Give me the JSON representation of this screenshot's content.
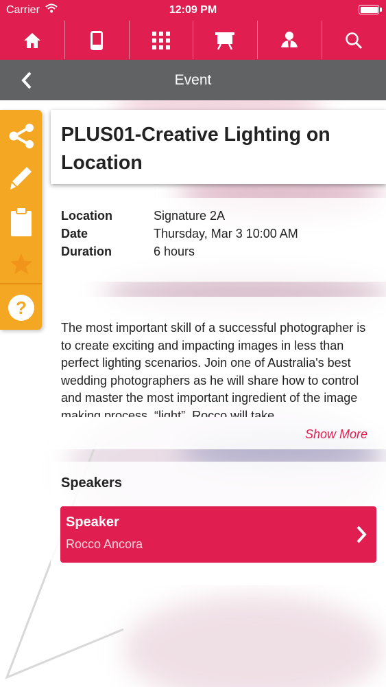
{
  "status_bar": {
    "carrier": "Carrier",
    "time": "12:09 PM"
  },
  "nav_icons": [
    "home-icon",
    "tablet-icon",
    "qr-code-icon",
    "presentation-board-icon",
    "person-icon",
    "search-icon"
  ],
  "header": {
    "title": "Event"
  },
  "sidebar": {
    "icons": [
      "share-icon",
      "pencil-icon",
      "clipboard-icon",
      "star-icon",
      "help-icon"
    ]
  },
  "event": {
    "title": "PLUS01-Creative Lighting on Location",
    "details": [
      {
        "label": "Location",
        "value": "Signature 2A"
      },
      {
        "label": "Date",
        "value": "Thursday, Mar 3 10:00 AM"
      },
      {
        "label": "Duration",
        "value": "6 hours"
      }
    ],
    "description": "The most important skill of a successful photographer is to create exciting and impacting images in less than perfect lighting scenarios. Join one of Australia's best wedding photographers as he will share how to control and master the most important ingredient of the image making process, “light”. Rocco will take",
    "show_more_label": "Show More"
  },
  "speakers": {
    "heading": "Speakers",
    "items": [
      {
        "role": "Speaker",
        "name": "Rocco Ancora"
      }
    ]
  },
  "colors": {
    "primary": "#e01e4f",
    "header_gray": "#606264",
    "sidebar_orange": "#f4a722"
  }
}
